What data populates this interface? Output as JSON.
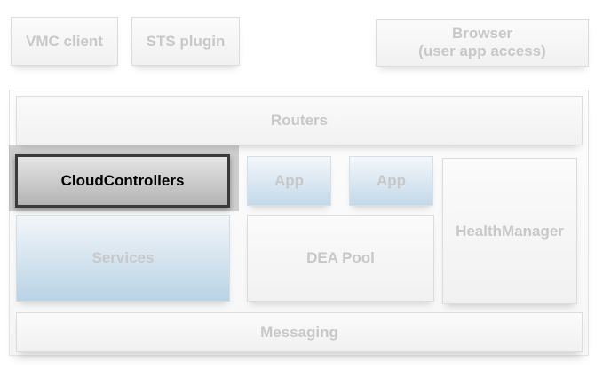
{
  "diagram": {
    "top_row": {
      "vmc_client": "VMC client",
      "sts_plugin": "STS plugin",
      "browser_line1": "Browser",
      "browser_line2": "(user app access)"
    },
    "routers": "Routers",
    "cloud_controllers": "CloudControllers",
    "app_1": "App",
    "app_2": "App",
    "health_manager": "HealthManager",
    "services": "Services",
    "dea_pool": "DEA Pool",
    "messaging": "Messaging"
  },
  "colors": {
    "selected_border": "#3a3a3a",
    "inactive_text": "#c8c8c8",
    "blue_tint": "#b9d3e6"
  }
}
